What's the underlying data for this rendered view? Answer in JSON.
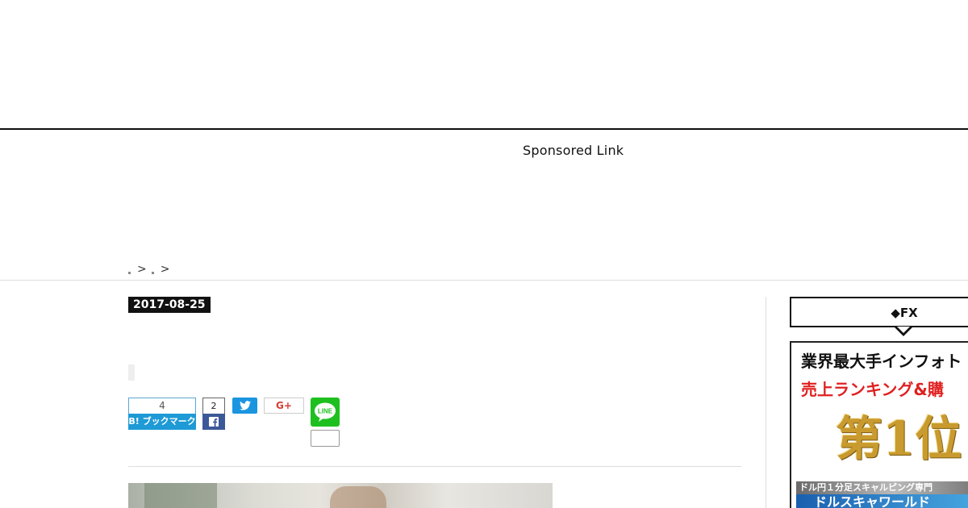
{
  "header": {
    "sponsored_label": "Sponsored Link"
  },
  "breadcrumb": {
    "separator": ">"
  },
  "article": {
    "date": "2017-08-25"
  },
  "share": {
    "hatena": {
      "count": "4",
      "label": "B! ブックマーク"
    },
    "facebook": {
      "count": "2",
      "icon": "facebook-icon"
    },
    "twitter": {
      "icon": "twitter-icon"
    },
    "gplus": {
      "label": "G+"
    },
    "line": {
      "label": "LINE"
    }
  },
  "sidebar": {
    "fx_title": "◆FX",
    "ad": {
      "line1": "業界最大手インフォト",
      "line2": "売上ランキング&購",
      "rank": "第1位",
      "strip": "ドル円１分足スキャルピング専門",
      "bottom": "ドルスキャワールド"
    }
  },
  "colors": {
    "hatena": "#1e9ad6",
    "facebook": "#3b5998",
    "twitter": "#1b95e0",
    "gplus": "#d73d32",
    "line": "#1dc01f",
    "ad_red": "#e02020"
  }
}
